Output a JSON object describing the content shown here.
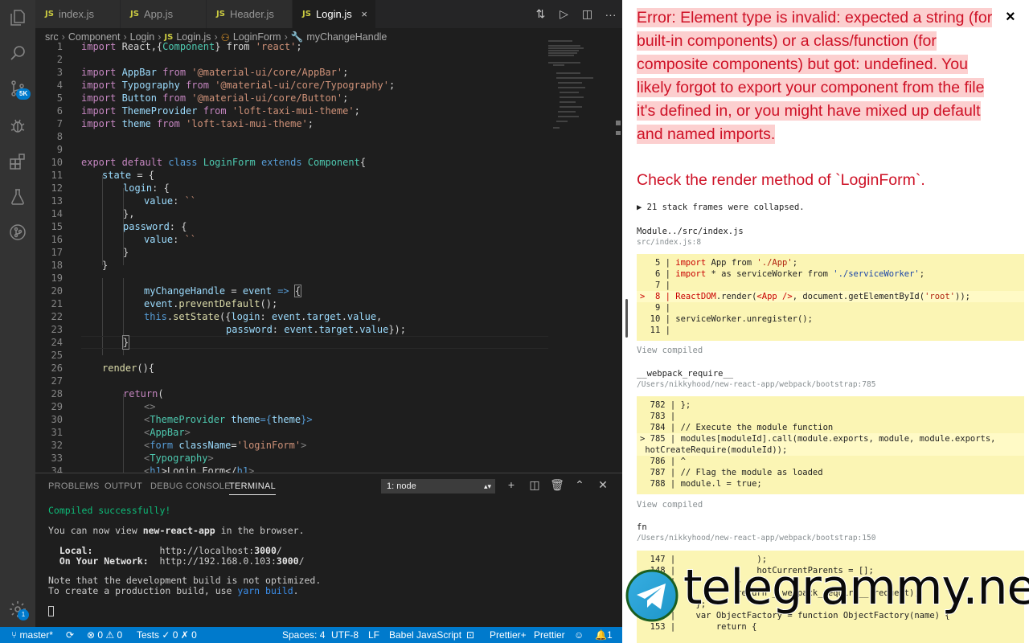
{
  "tabs": [
    {
      "icon": "JS",
      "label": "index.js"
    },
    {
      "icon": "JS",
      "label": "App.js"
    },
    {
      "icon": "JS",
      "label": "Header.js"
    },
    {
      "icon": "JS",
      "label": "Login.js",
      "close": "×"
    }
  ],
  "tab_actions": {
    "more": "···"
  },
  "breadcrumb": {
    "p1": "src",
    "p2": "Component",
    "p3": "Login",
    "file": "Login.js",
    "cls": "LoginForm",
    "method": "myChangeHandle"
  },
  "activity": {
    "badge": "5K",
    "settings_badge": "1"
  },
  "code_lines": [
    {
      "n": "1"
    },
    {
      "n": "2"
    },
    {
      "n": "3"
    },
    {
      "n": "4"
    },
    {
      "n": "5"
    },
    {
      "n": "6"
    },
    {
      "n": "7"
    },
    {
      "n": "8"
    },
    {
      "n": "9"
    },
    {
      "n": "10"
    },
    {
      "n": "11"
    },
    {
      "n": "12"
    },
    {
      "n": "13"
    },
    {
      "n": "14"
    },
    {
      "n": "15"
    },
    {
      "n": "16"
    },
    {
      "n": "17"
    },
    {
      "n": "18"
    },
    {
      "n": "19"
    },
    {
      "n": "20"
    },
    {
      "n": "21"
    },
    {
      "n": "22"
    },
    {
      "n": "23"
    },
    {
      "n": "24"
    },
    {
      "n": "25"
    },
    {
      "n": "26"
    },
    {
      "n": "27"
    },
    {
      "n": "28"
    },
    {
      "n": "29"
    },
    {
      "n": "30"
    },
    {
      "n": "31"
    },
    {
      "n": "32"
    },
    {
      "n": "33"
    },
    {
      "n": "34"
    }
  ],
  "code": {
    "l1": [
      "import",
      " React,{",
      "Component",
      "} from ",
      "'react'",
      ";"
    ],
    "l3": [
      "import",
      " AppBar ",
      "from",
      " '@material-ui/core/AppBar'",
      ";"
    ],
    "l4": [
      "import",
      " Typography ",
      "from",
      " '@material-ui/core/Typography'",
      ";"
    ],
    "l5": [
      "import",
      " Button ",
      "from",
      " '@material-ui/core/Button'",
      ";"
    ],
    "l6": [
      "import",
      " ThemeProvider ",
      "from",
      " 'loft-taxi-mui-theme'",
      ";"
    ],
    "l7": [
      "import",
      " theme ",
      "from",
      " 'loft-taxi-mui-theme'",
      ";"
    ],
    "l10": [
      "export default",
      " class ",
      "LoginForm",
      " extends ",
      "Component",
      "{"
    ],
    "l11": [
      "state",
      " = {"
    ],
    "l12": [
      "login",
      ": {"
    ],
    "l13": [
      "value",
      ": ",
      "``"
    ],
    "l14": "},",
    "l15": [
      "password",
      ": {"
    ],
    "l16": [
      "value",
      ": ",
      "``"
    ],
    "l17": "}",
    "l18": "}",
    "l20": [
      "myChangeHandle",
      " = ",
      "event",
      " => ",
      "{"
    ],
    "l21": [
      "event",
      ".",
      "preventDefault",
      "();"
    ],
    "l22": [
      "this",
      ".",
      "setState",
      "({",
      "login",
      ": ",
      "event",
      ".",
      "target",
      ".",
      "value",
      ","
    ],
    "l23": [
      "password",
      ": ",
      "event",
      ".",
      "target",
      ".",
      "value",
      "});"
    ],
    "l24": "}",
    "l26": [
      "render",
      "(){"
    ],
    "l28": [
      "return",
      "("
    ],
    "l29": "<>",
    "l30": [
      "<",
      "ThemeProvider",
      " theme",
      "={",
      "theme",
      "}>"
    ],
    "l31": [
      "<",
      "AppBar",
      ">"
    ],
    "l32": [
      "<",
      "form",
      " className",
      "=",
      "'loginForm'",
      ">"
    ],
    "l33": [
      "<",
      "Typography",
      ">"
    ],
    "l34": [
      "<",
      "h1",
      ">Login Form</",
      "h1",
      ">"
    ]
  },
  "panel": {
    "tabs": [
      "PROBLEMS",
      "OUTPUT",
      "DEBUG CONSOLE",
      "TERMINAL"
    ],
    "terminal_select": "1: node",
    "lines": {
      "t1": "Compiled successfully!",
      "t2a": "You can now view ",
      "t2b": "new-react-app",
      "t2c": " in the browser.",
      "t3a": "  Local:            ",
      "t3b": "http://localhost:",
      "t3c": "3000",
      "t3d": "/",
      "t4a": "  On Your Network:  ",
      "t4b": "http://192.168.0.103:",
      "t4c": "3000",
      "t4d": "/",
      "t5": "Note that the development build is not optimized.",
      "t6a": "To create a production build, use ",
      "t6b": "yarn build",
      "t6c": "."
    }
  },
  "status": {
    "branch": "master*",
    "errors": "0",
    "warnings": "0",
    "tests": "Tests",
    "tests_pass": "0",
    "tests_fail": "0",
    "spaces": "Spaces: 4",
    "encoding": "UTF-8",
    "eol": "LF",
    "language": "Babel JavaScript",
    "prettier_plus": "Prettier+",
    "prettier": "Prettier",
    "notifications": "1"
  },
  "overlay": {
    "title": "Error: Element type is invalid: expected a string (for built-in components) or a class/function (for composite components) but got: undefined. You likely forgot to export your component from the file it's defined in, or you might have mixed up default and named imports.",
    "close": "×",
    "subtitle": "Check the render method of `LoginForm`.",
    "collapsed": "▶ 21 stack frames were collapsed.",
    "frame1": {
      "name": "Module../src/index.js",
      "path": "src/index.js:8",
      "lines": [
        "   5 | ",
        "   6 | ",
        "   7 |",
        ">  8 | ",
        "   9 |",
        "  10 | ",
        "  11 |"
      ],
      "code5a": "import",
      "code5b": " App ",
      "code5c": "from",
      "code5d": " './App'",
      "code5e": ";",
      "code6a": "import",
      "code6b": " * as serviceWorker ",
      "code6c": "from",
      "code6d": " './serviceWorker'",
      "code6e": ";",
      "code8a": "ReactDOM",
      "code8b": ".render(",
      "code8c": "<App />",
      "code8d": ", document.getElementById(",
      "code8e": "'root'",
      "code8f": "));",
      "code10": "serviceWorker.unregister();",
      "view": "View compiled"
    },
    "frame2": {
      "name": "__webpack_require__",
      "path": "/Users/nikkyhood/new-react-app/webpack/bootstrap:785",
      "l1": "  782 | };",
      "l2": "  783 |",
      "l3": "  784 | // Execute the module function",
      "l4": "> 785 | modules[moduleId].call(module.exports, module, module.exports,",
      "l5": " hotCreateRequire(moduleId));",
      "l6": "  786 | ^",
      "l7": "  787 | // Flag the module as loaded",
      "l8": "  788 | module.l = true;",
      "view": "View compiled"
    },
    "frame3": {
      "name": "fn",
      "path": "/Users/nikkyhood/new-react-app/webpack/bootstrap:150",
      "l1": "  147 |                );",
      "l2": "  148 |                hotCurrentParents = [];",
      "l3": "  149 |            }",
      "l4": "  150 |            return __webpack_require__(request);",
      "l5": "  151 |    };",
      "l6": "  152 |    var ObjectFactory = function ObjectFactory(name) {",
      "l7": "  153 |        return {"
    }
  },
  "watermark": {
    "text": "telegrammy.net"
  }
}
